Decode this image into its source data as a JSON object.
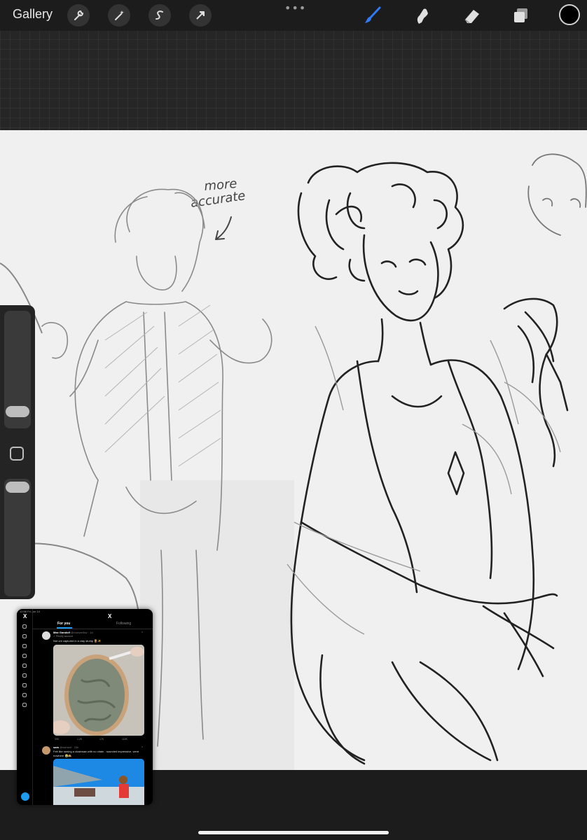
{
  "colors": {
    "toolbar_bg": "#1c1c1c",
    "brush_accent": "#2f7bf5",
    "current_color": "#000000",
    "canvas_bg": "#f0f0f0"
  },
  "toolbar": {
    "gallery_label": "Gallery",
    "more_label": "•••",
    "left_tools": [
      "wrench-icon",
      "magic-wand-icon",
      "selection-s-icon",
      "transform-arrow-icon"
    ],
    "right_tools": [
      "brush-icon",
      "smudge-icon",
      "eraser-icon",
      "layers-icon"
    ],
    "active_tool": "brush"
  },
  "canvas": {
    "annotation_line1": "more",
    "annotation_line2": "accurate"
  },
  "sidebar": {
    "brush_size_level": 0.35,
    "opacity_level": 0.05
  },
  "pip": {
    "status_time": "12:56  Fri Jun 14",
    "tabs": {
      "for_you": "For you",
      "following": "Following"
    },
    "post1": {
      "name": "Max Gandolf",
      "handle": "@maxwellcw · 1d",
      "sub": "✓ Priority account",
      "text": "Not cnt captured in a clay stump 🪵✨",
      "stats": [
        "395",
        "1.2K",
        "17K",
        "118K"
      ]
    },
    "post2": {
      "name": "sam",
      "handle": "@samsof · 23h",
      "text1": "Felt like seeing a chainsaw with no chain - sounded impressive, went",
      "text2": "nowhere 😭🙈"
    }
  }
}
